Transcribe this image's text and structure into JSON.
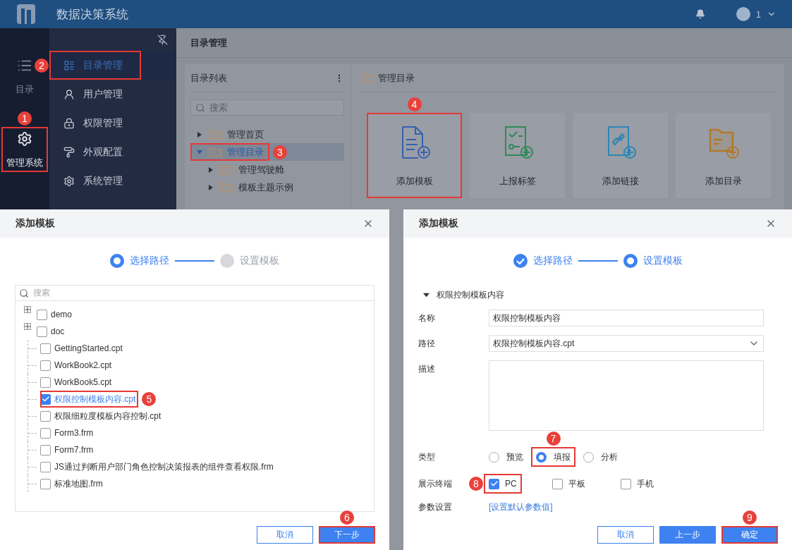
{
  "header": {
    "title": "数据决策系统",
    "user": "1"
  },
  "nav_rail": [
    {
      "label": "目录",
      "selected": false
    },
    {
      "label": "管理系统",
      "selected": true,
      "callout": "1"
    }
  ],
  "menu": [
    {
      "label": "目录管理",
      "selected": true,
      "callout": "2"
    },
    {
      "label": "用户管理",
      "selected": false
    },
    {
      "label": "权限管理",
      "selected": false
    },
    {
      "label": "外观配置",
      "selected": false
    },
    {
      "label": "系统管理",
      "selected": false
    }
  ],
  "page_title": "目录管理",
  "catalog": {
    "title": "目录列表",
    "search_placeholder": "搜索",
    "tree": [
      {
        "label": "管理首页",
        "expanded": false,
        "selected": false
      },
      {
        "label": "管理目录",
        "expanded": true,
        "selected": true,
        "callout": "3",
        "children": [
          {
            "label": "管理驾驶舱",
            "expanded": false,
            "selected": false
          },
          {
            "label": "模板主题示例",
            "expanded": false,
            "selected": false
          }
        ]
      }
    ]
  },
  "breadcrumb": "管理目录",
  "actions": [
    {
      "label": "添加模板",
      "color": "#3461ad",
      "callout": "4"
    },
    {
      "label": "上报标签",
      "color": "#2e8a55"
    },
    {
      "label": "添加链接",
      "color": "#2b86b5"
    },
    {
      "label": "添加目录",
      "color": "#b07a2a"
    }
  ],
  "dialog_path": {
    "title": "添加模板",
    "steps": [
      {
        "label": "选择路径",
        "done": false,
        "selected": true
      },
      {
        "label": "设置模板",
        "done": false,
        "selected": false
      }
    ],
    "search_placeholder": "搜索",
    "files": [
      {
        "label": "demo",
        "kind": "folder",
        "checked": false
      },
      {
        "label": "doc",
        "kind": "folder",
        "checked": false
      },
      {
        "label": "GettingStarted.cpt",
        "kind": "file",
        "checked": false
      },
      {
        "label": "WorkBook2.cpt",
        "kind": "file",
        "checked": false
      },
      {
        "label": "WorkBook5.cpt",
        "kind": "file",
        "checked": false
      },
      {
        "label": "权限控制模板内容.cpt",
        "kind": "file",
        "checked": true,
        "callout": "5"
      },
      {
        "label": "权限细粒度模板内容控制.cpt",
        "kind": "file",
        "checked": false
      },
      {
        "label": "Form3.frm",
        "kind": "file",
        "checked": false
      },
      {
        "label": "Form7.frm",
        "kind": "file",
        "checked": false
      },
      {
        "label": "JS通过判断用户部门角色控制决策报表的组件查看权限.frm",
        "kind": "file",
        "checked": false
      },
      {
        "label": "标准地图.frm",
        "kind": "file",
        "checked": false
      }
    ],
    "buttons": [
      {
        "label": "取消",
        "kind": "secondary"
      },
      {
        "label": "下一步",
        "kind": "primary",
        "callout": "6"
      }
    ]
  },
  "dialog_settings": {
    "title": "添加模板",
    "steps": [
      {
        "label": "选择路径",
        "done": true,
        "selected": false
      },
      {
        "label": "设置模板",
        "done": false,
        "selected": true
      }
    ],
    "section": {
      "label": "权限控制模板内容",
      "expanded": true
    },
    "name": {
      "label": "名称",
      "value": "权限控制模板内容"
    },
    "path": {
      "label": "路径",
      "value": "权限控制模板内容.cpt"
    },
    "description": {
      "label": "描述"
    },
    "type": {
      "label": "类型",
      "options": [
        {
          "label": "预览",
          "selected": false
        },
        {
          "label": "填报",
          "selected": true,
          "callout": "7"
        },
        {
          "label": "分析",
          "selected": false
        }
      ]
    },
    "terminals": {
      "label": "展示终端",
      "options": [
        {
          "label": "PC",
          "checked": true,
          "callout": "8"
        },
        {
          "label": "平板",
          "checked": false
        },
        {
          "label": "手机",
          "checked": false
        }
      ]
    },
    "params": {
      "label": "参数设置",
      "link": "[设置默认参数值]"
    },
    "buttons": [
      {
        "label": "取消",
        "kind": "secondary"
      },
      {
        "label": "上一步",
        "kind": "primary"
      },
      {
        "label": "确定",
        "kind": "primary",
        "callout": "9"
      }
    ]
  }
}
